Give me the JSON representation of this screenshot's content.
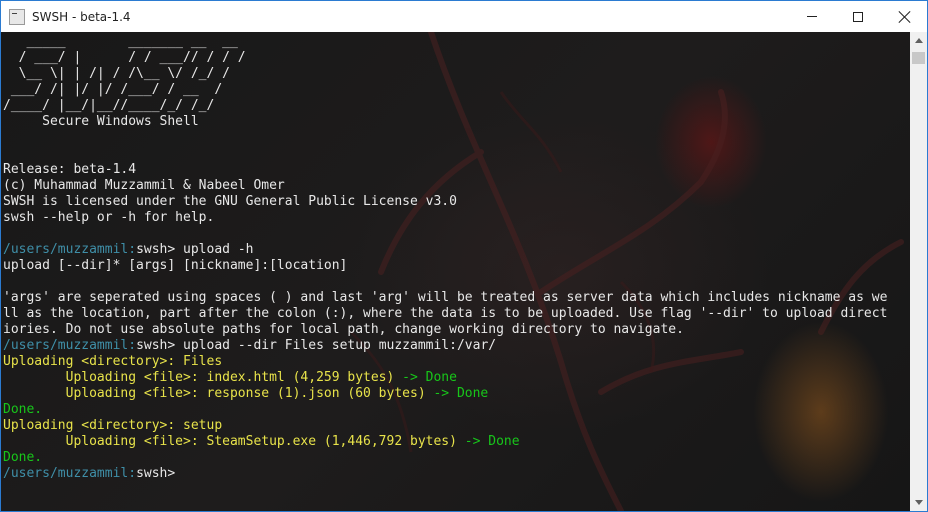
{
  "window": {
    "title": "SWSH - beta-1.4",
    "icon": "console-icon",
    "controls": [
      "minimize-icon",
      "maximize-icon",
      "close-icon"
    ],
    "border_color": "#2b7bd1"
  },
  "colors": {
    "prompt": "#3f8fa8",
    "yellow": "#e8e34a",
    "green": "#18c61a",
    "text": "#e8e8e8"
  },
  "terminal": {
    "banner": [
      "   _____        _______ __  __",
      "  / ___/ |      / / ___// / / /",
      "  \\__ \\| | /| / /\\__ \\/ /_/ /",
      " ___/ /| |/ |/ /___/ / __  /",
      "/____/ |__/|__//____/_/ /_/",
      "     Secure Windows Shell"
    ],
    "info": [
      "Release: beta-1.4",
      "(c) Muhammad Muzzammil & Nabeel Omer",
      "SWSH is licensed under the GNU General Public License v3.0",
      "swsh --help or -h for help."
    ],
    "prompt_path": "/users/muzzammil:",
    "prompt_name": "swsh>",
    "cmd1": " upload -h",
    "usage": "upload [--dir]* [args] [nickname]:[location]",
    "desc": [
      "'args' are seperated using spaces ( ) and last 'arg' will be treated as server data which includes nickname as we",
      "ll as the location, part after the colon (:), where the data is to be uploaded. Use flag '--dir' to upload direct",
      "iories. Do not use absolute paths for local path, change working directory to navigate."
    ],
    "cmd2": " upload --dir Files setup muzzammil:/var/",
    "dir1": "Uploading <directory>: Files",
    "file1": "        Uploading <file>: index.html (4,259 bytes)",
    "file1_status": " -> Done",
    "file2": "        Uploading <file>: response (1).json (60 bytes)",
    "file2_status": " -> Done",
    "done1": "Done.",
    "dir2": "Uploading <directory>: setup",
    "file3": "        Uploading <file>: SteamSetup.exe (1,446,792 bytes)",
    "file3_status": " -> Done",
    "done2": "Done."
  },
  "scrollbar": {
    "up_icon": "scroll-up-arrow-icon",
    "down_icon": "scroll-down-arrow-icon"
  }
}
